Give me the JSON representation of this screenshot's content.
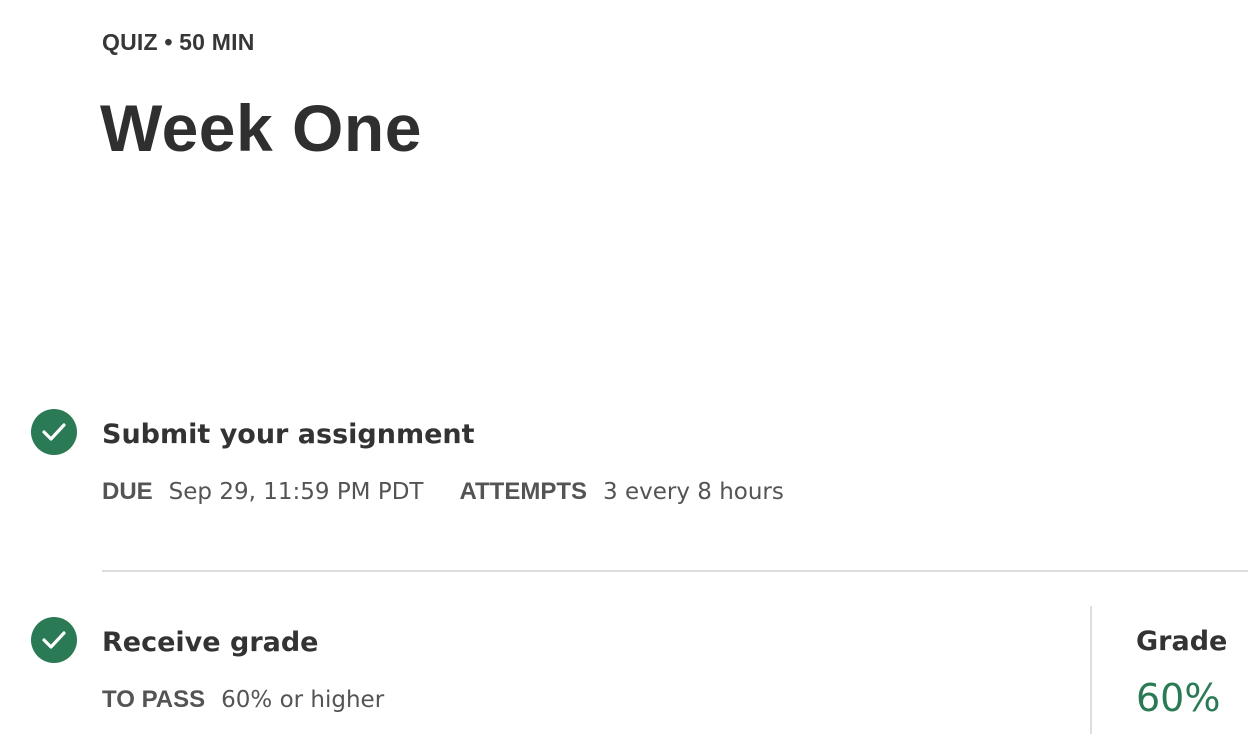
{
  "header": {
    "meta": "QUIZ • 50 MIN",
    "title": "Week One"
  },
  "steps": [
    {
      "title": "Submit your assignment",
      "status_icon": "check-circle-icon",
      "details": [
        {
          "label": "DUE",
          "value": "Sep 29, 11:59 PM PDT"
        },
        {
          "label": "ATTEMPTS",
          "value": "3 every 8 hours"
        }
      ]
    },
    {
      "title": "Receive grade",
      "status_icon": "check-circle-icon",
      "details": [
        {
          "label": "TO PASS",
          "value": "60% or higher"
        }
      ]
    }
  ],
  "grade": {
    "label": "Grade",
    "value": "60%"
  },
  "colors": {
    "accent": "#2a7a55",
    "text": "#333333",
    "muted": "#545454",
    "divider": "#dddddd"
  }
}
